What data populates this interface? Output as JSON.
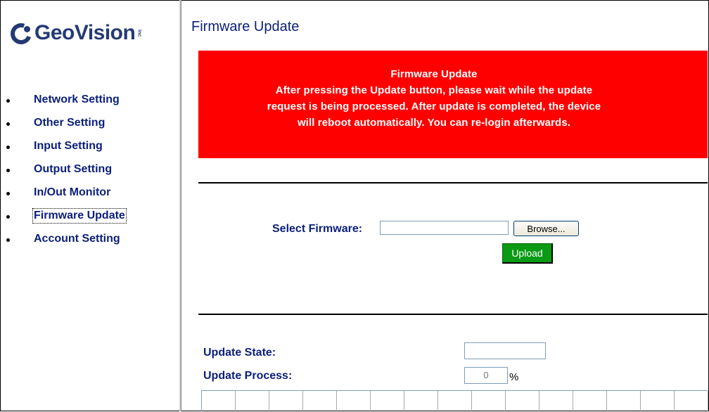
{
  "brand": {
    "name": "GeoVision",
    "suffix": "inc"
  },
  "sidebar": {
    "items": [
      {
        "label": "Network Setting"
      },
      {
        "label": "Other Setting"
      },
      {
        "label": "Input Setting"
      },
      {
        "label": "Output Setting"
      },
      {
        "label": "In/Out Monitor"
      },
      {
        "label": "Firmware Update",
        "active": true
      },
      {
        "label": "Account Setting"
      }
    ]
  },
  "main": {
    "title": "Firmware Update",
    "notice": {
      "heading": "Firmware Update",
      "lines": [
        "After pressing the Update button, please wait while the update",
        "request is being processed. After update is completed, the device",
        "will reboot automatically. You can re-login afterwards."
      ]
    },
    "select_firmware": {
      "label": "Select Firmware:",
      "value": "",
      "browse_label": "Browse..."
    },
    "upload_label": "Upload",
    "update_state": {
      "label": "Update State:",
      "value": ""
    },
    "update_process": {
      "label": "Update Process:",
      "value": "0",
      "unit": "%"
    },
    "progress": {
      "fraction": 0
    }
  },
  "colors": {
    "brand": "#243a74",
    "link": "#0b1f7a",
    "notice_bg": "#ff0000",
    "upload_bg": "#0a9a14"
  }
}
